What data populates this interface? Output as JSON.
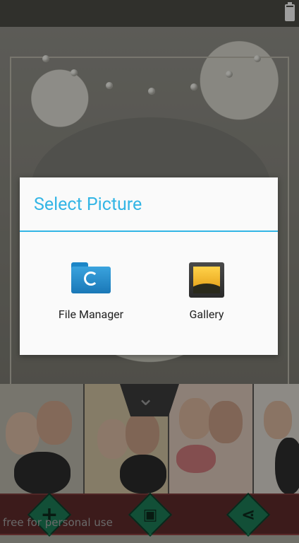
{
  "dialog": {
    "title": "Select Picture",
    "options": [
      {
        "label": "File Manager",
        "icon": "folder-sync-icon"
      },
      {
        "label": "Gallery",
        "icon": "gallery-image-icon"
      }
    ]
  },
  "thumbnail_strip": {
    "collapse_icon": "chevron-down-icon"
  },
  "toolbar": {
    "buttons": [
      {
        "icon": "add-icon",
        "glyph": "+"
      },
      {
        "icon": "save-icon",
        "glyph": "▣"
      },
      {
        "icon": "share-icon",
        "glyph": "⋖"
      }
    ]
  },
  "watermark": "free for personal use",
  "colors": {
    "accent": "#33b5e5",
    "toolbar_bg": "#5c2a2a",
    "tool_button": "#1d7a55"
  }
}
